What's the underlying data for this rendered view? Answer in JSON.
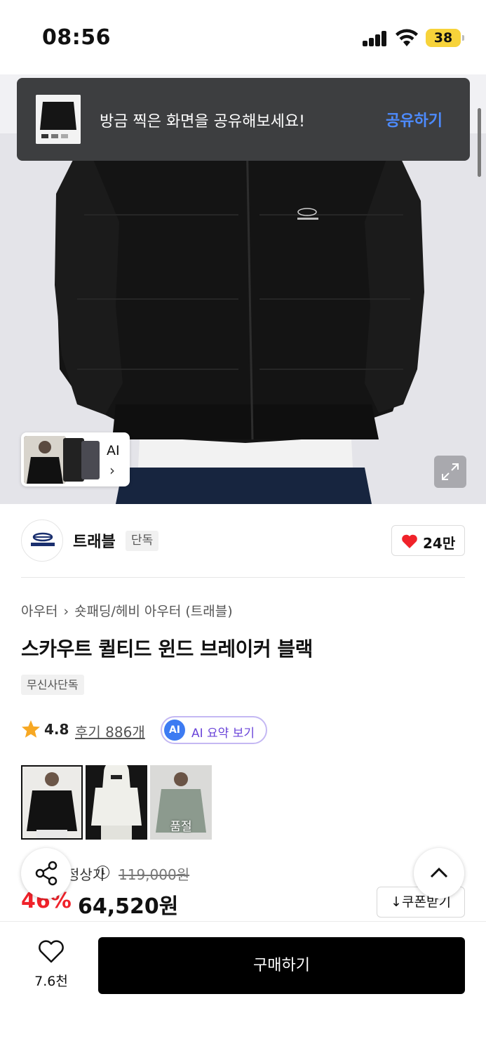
{
  "status_bar": {
    "time": "08:56",
    "battery": "38"
  },
  "toast": {
    "message": "방금 찍은 화면을 공유해보세요!",
    "action": "공유하기"
  },
  "hero": {
    "thumb_strip_label": "AI",
    "thumb_strip_arrow": "›"
  },
  "brand": {
    "name": "트래블",
    "tag": "단독",
    "likes": "24만"
  },
  "product": {
    "breadcrumb": [
      "아우터",
      "숏패딩/헤비 아우터 (트래블)"
    ],
    "title": "스카우트 퀼티드 윈드 브레이커 블랙",
    "badge": "무신사단독",
    "rating": "4.8",
    "review_link": "후기 886개",
    "ai_badge": "AI",
    "ai_summary": "AI 요약 보기"
  },
  "swatches": [
    {
      "name": "black",
      "soldout": ""
    },
    {
      "name": "white",
      "soldout": ""
    },
    {
      "name": "gray",
      "soldout": "품절"
    }
  ],
  "price": {
    "label": "정상가",
    "original": "119,000원",
    "discount": "46%",
    "sale": "64,520원",
    "coupon": "↓쿠폰받기"
  },
  "bottom": {
    "wish_count": "7.6천",
    "buy": "구매하기"
  },
  "colors": {
    "accent_red": "#f0222a",
    "link_blue": "#4d8bff",
    "ai_purple": "#6b45d9"
  },
  "icons": [
    "signal-icon",
    "wifi-icon",
    "expand-icon",
    "heart-icon",
    "star-icon",
    "info-icon",
    "share-icon",
    "chevron-up-icon",
    "heart-outline-icon"
  ]
}
